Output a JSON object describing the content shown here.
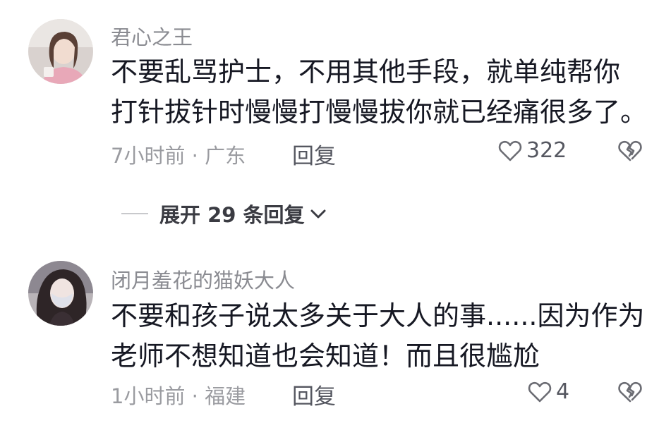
{
  "comments": [
    {
      "username": "君心之王",
      "lines": [
        "不要乱骂护士，不用其他手段，就单纯帮你",
        "打针拔针时慢慢打慢慢拔你就已经痛很多了。"
      ],
      "time_location": "7小时前 · 广东",
      "reply_label": "回复",
      "likes": "322"
    },
    {
      "username": "闭月羞花的猫妖大人",
      "lines": [
        "不要和孩子说太多关于大人的事......因为作为",
        "老师不想知道也会知道！而且很尴尬"
      ],
      "time_location": "1小时前 · 福建",
      "reply_label": "回复",
      "likes": "4"
    }
  ],
  "expand_replies": {
    "label": "展开 29 条回复"
  }
}
